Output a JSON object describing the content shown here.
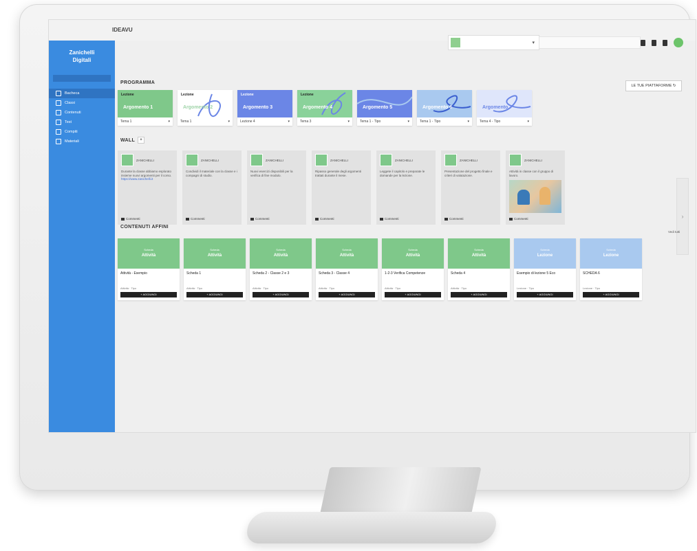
{
  "colors": {
    "sidebar": "#3a8be0",
    "green_card": "#7fc88a",
    "blue_card": "#6b86e6",
    "light_blue_card": "#a9c9ef",
    "button_dark": "#222222"
  },
  "topbar": {
    "brand": "IDEAVU",
    "school_select": "",
    "search_placeholder": ""
  },
  "sidebar": {
    "logo_line1": "Zanichelli",
    "logo_line2": "Digitali",
    "class_label": "",
    "items": [
      {
        "label": "Bacheca",
        "icon": "home-icon"
      },
      {
        "label": "Classi",
        "icon": "users-icon"
      },
      {
        "label": "Contenuti",
        "icon": "book-icon"
      },
      {
        "label": "Test",
        "icon": "grid-icon"
      },
      {
        "label": "Compiti",
        "icon": "pencil-icon"
      },
      {
        "label": "Materiali",
        "icon": "folder-icon"
      }
    ]
  },
  "main": {
    "programmi_title": "PROGRAMMA",
    "platform_button": "LE TUE PIATTAFORME ↻",
    "walls_title": "WALL",
    "contenuti_title": "CONTENUTI AFFINI",
    "see_all": "Vedi tutti",
    "programs": [
      {
        "tag": "Lezione",
        "name": "Argomento 1",
        "select": "Tema 1",
        "color": "#7fc88a"
      },
      {
        "tag": "Lezione",
        "name": "Argomento 2",
        "select": "Tema 1",
        "color": "#ffffff"
      },
      {
        "tag": "Lezione",
        "name": "Argomento 3",
        "select": "Lezione 4",
        "color": "#6b86e6"
      },
      {
        "tag": "Lezione",
        "name": "Argomento 4",
        "select": "Tema 3",
        "color": "#8ad29a"
      },
      {
        "tag": "",
        "name": "Argomento 5",
        "select": "Tema 1 - Tipo",
        "color": "#6b86e6"
      },
      {
        "tag": "",
        "name": "Argomento 6",
        "select": "Tema 1 - Tipo",
        "color": "#a9c9ef"
      },
      {
        "tag": "",
        "name": "Argomento 7",
        "select": "Tema 4 - Tipo",
        "color": "#dfe6fb"
      }
    ],
    "walls": [
      {
        "author": "ZANICHELLI",
        "text": "Durante la classe abbiamo esplorato insieme nuovi argomenti per il corso.",
        "link": "https://www.zanichelli.it",
        "foot": "Commenti"
      },
      {
        "author": "ZANICHELLI",
        "text": "Condividi il materiale con la classe e i compagni di studio.",
        "link": "",
        "foot": "Commenti"
      },
      {
        "author": "ZANICHELLI",
        "text": "Nuovi esercizi disponibili per la verifica di fine modulo.",
        "link": "",
        "foot": "Commenti"
      },
      {
        "author": "ZANICHELLI",
        "text": "Ripasso generale degli argomenti trattati durante il mese.",
        "link": "",
        "foot": "Commenti"
      },
      {
        "author": "ZANICHELLI",
        "text": "Leggete il capitolo e preparate le domande per la lezione.",
        "link": "",
        "foot": "Commenti"
      },
      {
        "author": "ZANICHELLI",
        "text": "Presentazione del progetto finale e criteri di valutazione.",
        "link": "",
        "foot": "Commenti"
      },
      {
        "author": "ZANICHELLI",
        "text": "Attività in classe con il gruppo di lavoro.",
        "link": "",
        "foot": "Commenti",
        "has_image": true
      }
    ],
    "contents": [
      {
        "kind": "Scheda",
        "art": "Attività",
        "title": "Attività - Esempio",
        "meta": "Attività · Tipo",
        "button": "+ AGGIUNGI",
        "color": "#7fc88a"
      },
      {
        "kind": "Scheda",
        "art": "Attività",
        "title": "Scheda 1",
        "meta": "Attività · Tipo",
        "button": "+ AGGIUNGI",
        "color": "#7fc88a"
      },
      {
        "kind": "Scheda",
        "art": "Attività",
        "title": "Scheda 2 - Classe 2 e 3",
        "meta": "Attività · Tipo",
        "button": "+ AGGIUNGI",
        "color": "#7fc88a"
      },
      {
        "kind": "Scheda",
        "art": "Attività",
        "title": "Scheda 3 - Classe 4",
        "meta": "Attività · Tipo",
        "button": "+ AGGIUNGI",
        "color": "#7fc88a"
      },
      {
        "kind": "Scheda",
        "art": "Attività",
        "title": "1-2-3 Verifica Competenze",
        "meta": "Attività · Tipo",
        "button": "+ AGGIUNGI",
        "color": "#7fc88a"
      },
      {
        "kind": "Scheda",
        "art": "Attività",
        "title": "Scheda 4",
        "meta": "Attività · Tipo",
        "button": "+ AGGIUNGI",
        "color": "#7fc88a"
      },
      {
        "kind": "Scheda",
        "art": "Lezione",
        "title": "Esempio di lezione 5 Eco",
        "meta": "Lezione · Tipo",
        "button": "+ AGGIUNGI",
        "color": "#a9c9ef"
      },
      {
        "kind": "Scheda",
        "art": "Lezione",
        "title": "SCHEDA 6",
        "meta": "Lezione · Tipo",
        "button": "+ AGGIUNGI",
        "color": "#a9c9ef"
      }
    ]
  }
}
